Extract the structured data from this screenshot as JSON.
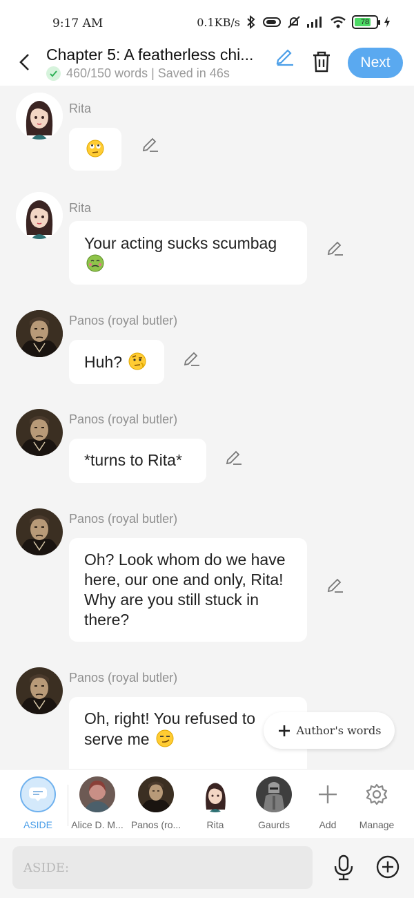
{
  "status_bar": {
    "time": "9:17 AM",
    "network_speed": "0.1KB/s",
    "battery": "78",
    "battery_level": 0.78
  },
  "header": {
    "title": "Chapter 5: A featherless chi...",
    "word_info": "460/150 words | Saved in 46s",
    "next_label": "Next"
  },
  "messages": [
    {
      "sender": "Rita",
      "text": "",
      "emoji": "rolling-eyes-emoji"
    },
    {
      "sender": "Rita",
      "text": "Your acting sucks scumbag",
      "emoji": "nauseated-face-emoji"
    },
    {
      "sender": "Panos (royal butler)",
      "text": "Huh? ",
      "emoji": "raised-eyebrow-emoji"
    },
    {
      "sender": "Panos (royal butler)",
      "text": "*turns to Rita*"
    },
    {
      "sender": "Panos (royal butler)",
      "text": "Oh? Look whom do we have here, our one and only, Rita! Why are you still stuck in there?"
    },
    {
      "sender": "Panos (royal butler)",
      "text": "Oh, right! You refused to serve me ",
      "emoji": "smirking-face-emoji"
    }
  ],
  "authors_words": {
    "label": "Author's words"
  },
  "characters": [
    {
      "label": "ASIDE",
      "icon": "aside-icon"
    },
    {
      "label": "Alice D. M..."
    },
    {
      "label": "Panos (ro..."
    },
    {
      "label": "Rita"
    },
    {
      "label": "Gaurds"
    },
    {
      "label": "Add",
      "icon": "add-icon"
    },
    {
      "label": "Manage",
      "icon": "gear-icon"
    }
  ],
  "input": {
    "placeholder": "ASIDE:"
  },
  "colors": {
    "accent": "#5aa9f0",
    "background": "#f4f4f4",
    "bubble": "#ffffff"
  }
}
